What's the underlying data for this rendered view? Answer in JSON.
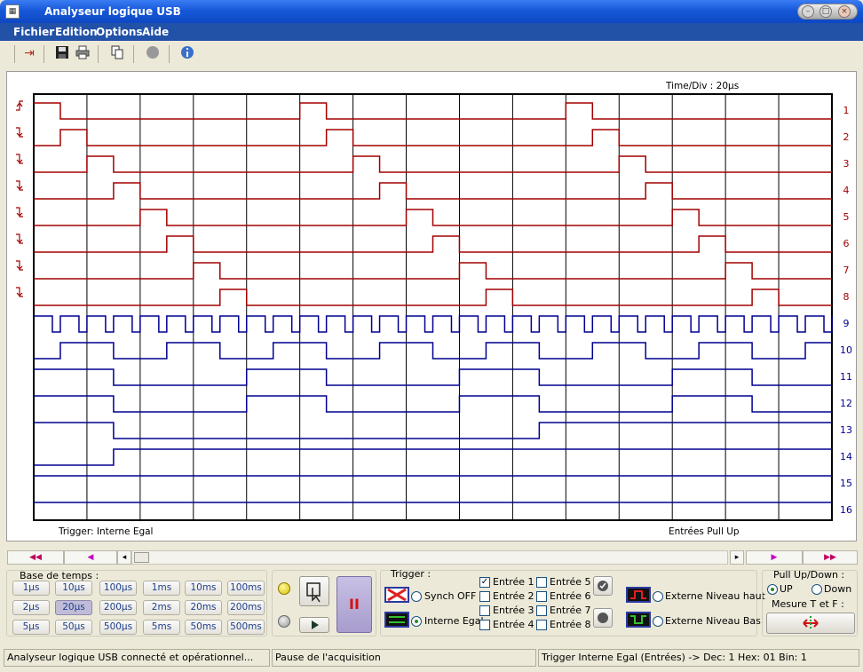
{
  "window": {
    "title": "Analyseur logique USB"
  },
  "menu": [
    "Fichier",
    "Edition",
    "Options",
    "Aide"
  ],
  "toolbar": {
    "icons": [
      "exit-icon",
      "save-icon",
      "print-icon",
      "copy-icon",
      "stop-icon",
      "info-icon"
    ]
  },
  "scope": {
    "time_div": "Time/Div : 20µs",
    "trigger_label": "Trigger: Interne Egal",
    "inputs_label": "Entrées Pull Up",
    "channels": [
      "1",
      "2",
      "3",
      "4",
      "5",
      "6",
      "7",
      "8",
      "9",
      "10",
      "11",
      "12",
      "13",
      "14",
      "15",
      "16"
    ],
    "trigger_edges": [
      "rising",
      "falling",
      "falling",
      "falling",
      "falling",
      "falling",
      "falling",
      "falling"
    ]
  },
  "navigation": {
    "far_left": "◀◀",
    "left": "◀",
    "right": "▶",
    "far_right": "▶▶"
  },
  "timebase": {
    "title": "Base de temps :",
    "buttons": [
      "1µs",
      "10µs",
      "100µs",
      "1ms",
      "10ms",
      "100ms",
      "2µs",
      "20µs",
      "200µs",
      "2ms",
      "20ms",
      "200ms",
      "5µs",
      "50µs",
      "500µs",
      "5ms",
      "50ms",
      "500ms"
    ],
    "selected": "20µs"
  },
  "acquisition": {
    "pause_symbol": "II"
  },
  "trigger": {
    "title": "Trigger :",
    "synch_off": "Synch OFF",
    "interne_egal": "Interne Egal",
    "selected": "Interne Egal",
    "entries": [
      {
        "label": "Entrée 1",
        "checked": true
      },
      {
        "label": "Entrée 2",
        "checked": false
      },
      {
        "label": "Entrée 3",
        "checked": false
      },
      {
        "label": "Entrée 4",
        "checked": false
      },
      {
        "label": "Entrée 5",
        "checked": false
      },
      {
        "label": "Entrée 6",
        "checked": false
      },
      {
        "label": "Entrée 7",
        "checked": false
      },
      {
        "label": "Entrée 8",
        "checked": false
      }
    ],
    "externe_haut": "Externe Niveau haut",
    "externe_bas": "Externe Niveau Bas"
  },
  "pullupdown": {
    "title": "Pull Up/Down :",
    "up": "UP",
    "down": "Down",
    "selected": "UP"
  },
  "mesure": {
    "title": "Mesure T et F :"
  },
  "status": {
    "left": "Analyseur logique USB connecté et opérationnel...",
    "middle": "Pause de l'acquisition",
    "right": "Trigger Interne Egal (Entrées) -> Dec: 1   Hex: 01   Bin: 1"
  },
  "colors": {
    "red_channel": "#a30000",
    "blue_channel": "#00008f",
    "selected_timebase": "#c0bcd7"
  }
}
